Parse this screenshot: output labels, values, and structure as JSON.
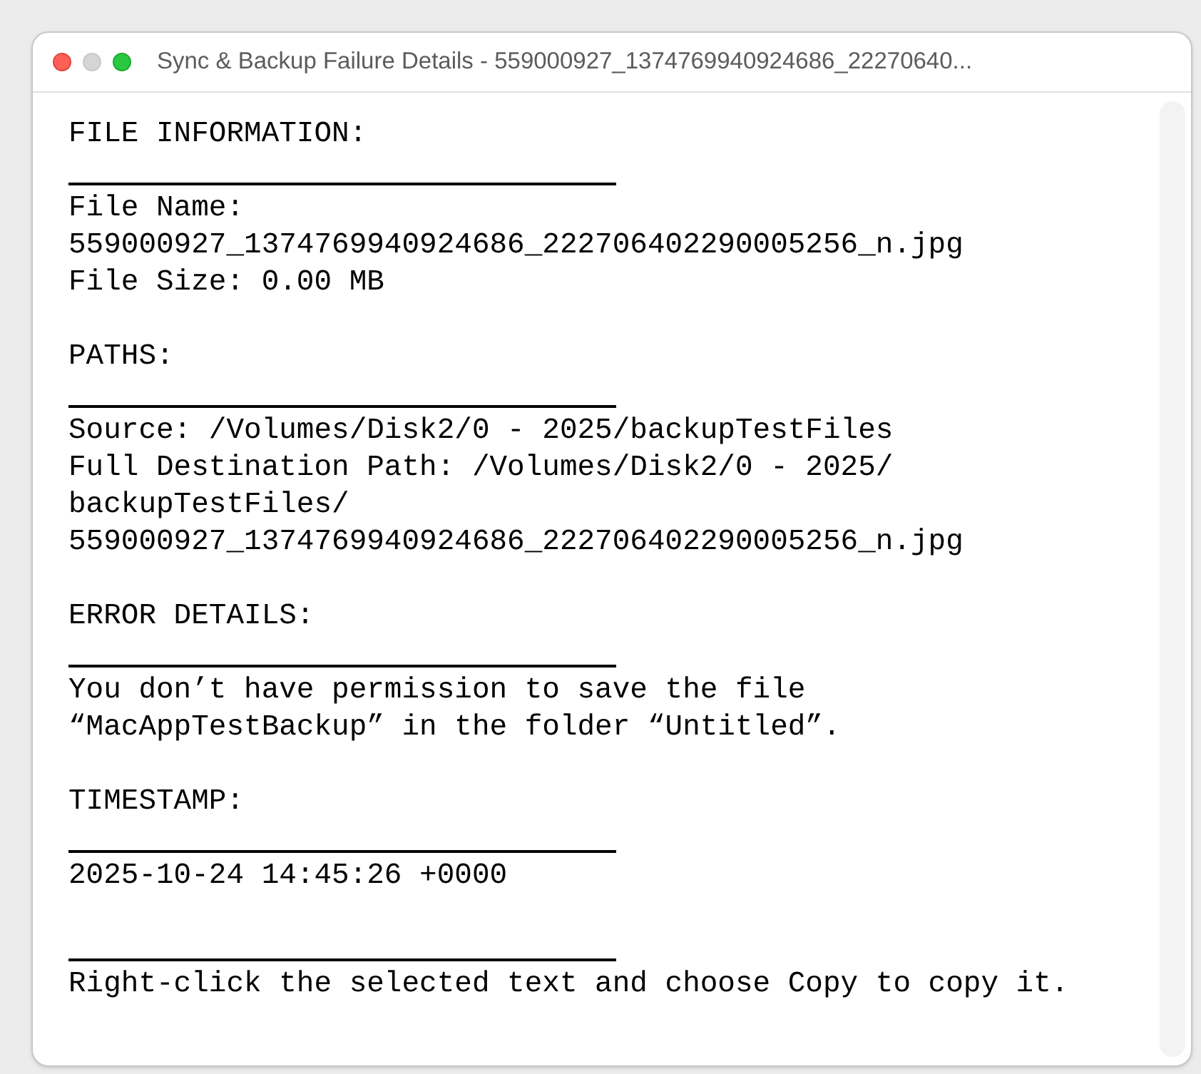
{
  "window": {
    "title": "Sync & Backup Failure Details - 559000927_1374769940924686_22270640..."
  },
  "sections": [
    {
      "heading": "FILE INFORMATION:",
      "lines": [
        "File Name:",
        "559000927_1374769940924686_222706402290005256_n.jpg",
        "File Size: 0.00 MB"
      ]
    },
    {
      "heading": "PATHS:",
      "lines": [
        "Source: /Volumes/Disk2/0 - 2025/backupTestFiles",
        "Full Destination Path: /Volumes/Disk2/0 - 2025/",
        "backupTestFiles/",
        "559000927_1374769940924686_222706402290005256_n.jpg"
      ]
    },
    {
      "heading": "ERROR DETAILS:",
      "lines": [
        "You don’t have permission to save the file",
        "“MacAppTestBackup” in the folder “Untitled”."
      ]
    },
    {
      "heading": "TIMESTAMP:",
      "lines": [
        "2025-10-24 14:45:26 +0000"
      ]
    },
    {
      "lines": [
        "Right-click the selected text and choose Copy to copy it."
      ]
    }
  ]
}
